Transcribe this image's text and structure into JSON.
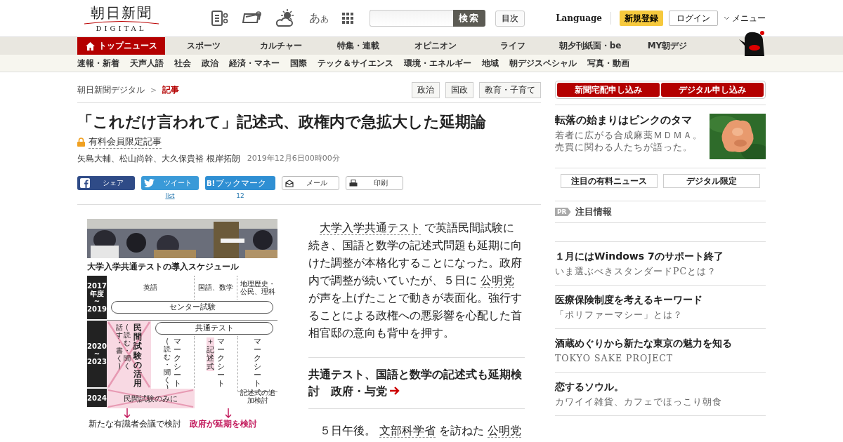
{
  "header": {
    "logo_title": "朝日新聞",
    "logo_subtitle": "DIGITAL",
    "text_size_large": "あ",
    "text_size_small": "あ",
    "search_button": "検索",
    "index_button": "目次",
    "language": "Language",
    "register": "新規登録",
    "login": "ログイン",
    "menu": "メニュー"
  },
  "nav": [
    {
      "label": "トップニュース",
      "selected": true
    },
    {
      "label": "スポーツ",
      "selected": false
    },
    {
      "label": "カルチャー",
      "selected": false
    },
    {
      "label": "特集・連載",
      "selected": false
    },
    {
      "label": "オピニオン",
      "selected": false
    },
    {
      "label": "ライフ",
      "selected": false
    },
    {
      "label": "朝夕刊紙面・be",
      "selected": false
    },
    {
      "label": "MY朝デジ",
      "selected": false
    }
  ],
  "subnav": [
    "速報・新着",
    "天声人語",
    "社会",
    "政治",
    "経済・マネー",
    "国際",
    "テック＆サイエンス",
    "環境・エネルギー",
    "地域",
    "朝デジスペシャル",
    "写真・動画"
  ],
  "breadcrumb": [
    {
      "label": "朝日新聞デジタル",
      "current": false
    },
    {
      "label": "記事",
      "current": true
    }
  ],
  "breadcrumb_separator": ">",
  "tags": [
    "政治",
    "国政",
    "教育・子育て"
  ],
  "article": {
    "title": "「これだけ言われて」記述式、政権内で急拡大した延期論",
    "badge": "有料会員限定記事",
    "authors": "矢島大輔、松山尚幹、大久保貴裕 根岸拓朗",
    "date": "2019年12月6日00時00分",
    "share": [
      {
        "kind": "facebook",
        "label": "シェア"
      },
      {
        "kind": "twitter",
        "label": "ツイート",
        "count": "list"
      },
      {
        "kind": "hatena",
        "icon_text": "B!",
        "label": "ブックマーク",
        "count": "12"
      },
      {
        "kind": "mail",
        "label": "メール"
      },
      {
        "kind": "print",
        "label": "印刷"
      }
    ],
    "figure": {
      "title": "大学入学共通テストの導入スケジュール",
      "subjects": [
        "英語",
        "国語、数学",
        "地理歴史・公民、理科"
      ],
      "periods": [
        {
          "lines": [
            "2017",
            "年度",
            "~",
            "2019"
          ]
        },
        {
          "lines": [
            "2020",
            "~",
            "2023"
          ]
        },
        {
          "lines": [
            "2024"
          ]
        }
      ],
      "band_1": "センター試験",
      "band_2": "共通テスト",
      "cancelled_main": "民間試験の活用",
      "cancelled_sub": [
        "話す・書く)",
        "(読む・聞く"
      ],
      "english_mark": "マークシート",
      "english_mark_note": "(読む・聞く)",
      "jp_math_mark": "マークシート",
      "jp_math_extra": "＋記述式",
      "social_mark": "マークシート",
      "cancelled_2024": "民間試験のみに",
      "note_2024": "記述式の追加検討",
      "outcomes": [
        {
          "text": "新たな有識者会議で検討",
          "emphasis": false
        },
        {
          "text": "政府が延期を検討",
          "emphasis": true
        }
      ]
    },
    "paragraphs": [
      [
        {
          "text": "大学入学共通テスト",
          "link": true
        },
        {
          "text": " で英語民間試験に続き、国語と数学の記述式問題も延期に向けた調整が本格化することになった。政府内で調整が続いていたが、５日に ",
          "link": false
        },
        {
          "text": "公明党",
          "link": true
        },
        {
          "text": "が声を上げたことで動きが表面化。強行することによる政権への悪影響を心配した首相官邸の意向も背中を押す。",
          "link": false
        }
      ]
    ],
    "related": "共通テスト、国語と数学の記述式も延期検討　政府・与党",
    "paragraphs_after": [
      [
        {
          "text": "５日午後。 ",
          "link": false
        },
        {
          "text": "文部科学省",
          "link": true
        },
        {
          "text": " を訪ねた ",
          "link": false
        },
        {
          "text": "公明党",
          "link": true
        }
      ]
    ]
  },
  "sidebar": {
    "subscribe": [
      "新聞宅配申し込み",
      "デジタル申し込み"
    ],
    "feature": {
      "title": "転落の始まりはピンクのタマ",
      "description": "若者に広がる合成麻薬ＭＤＭＡ。売買に関わる人たちが語った。"
    },
    "links": [
      "注目の有料ニュース",
      "デジタル限定"
    ],
    "pr": {
      "badge": "PR",
      "title": "注目情報"
    },
    "promos": [
      {
        "title": "１月にはWindows 7のサポート終了",
        "description": "いま選ぶべきスタンダードPCとは？"
      },
      {
        "title": "医療保険制度を考えるキーワード",
        "description": "「ポリファーマシー」とは？"
      },
      {
        "title": "酒蔵めぐりから新たな東京の魅力を知る",
        "description": "TOKYO SAKE PROJECT"
      },
      {
        "title": "恋するソウル。",
        "description": "カワイイ雑貨、カフェでほっこり朝食"
      }
    ]
  }
}
